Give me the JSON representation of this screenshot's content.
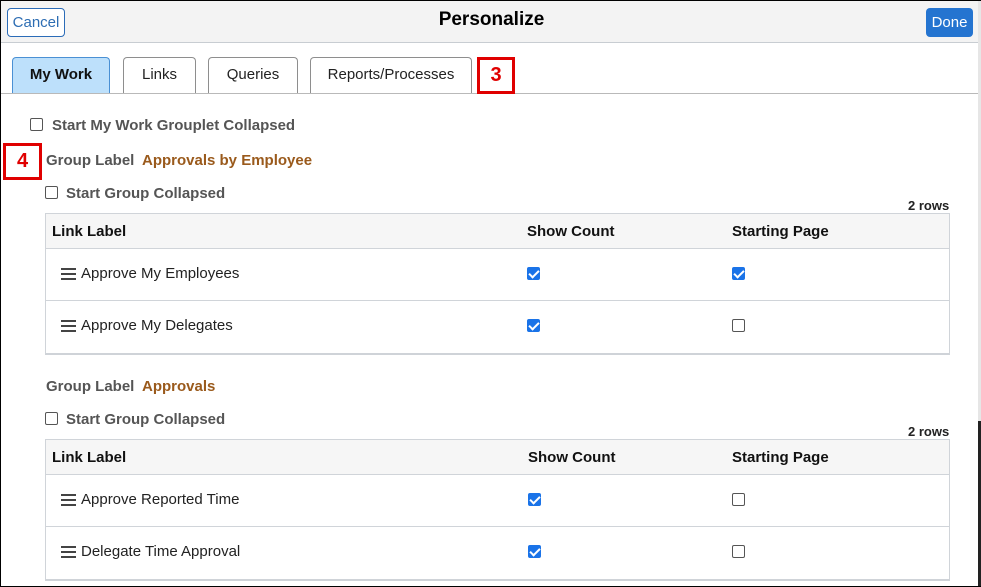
{
  "header": {
    "title": "Personalize",
    "cancel_label": "Cancel",
    "done_label": "Done"
  },
  "tabs": [
    {
      "label": "My Work",
      "active": true
    },
    {
      "label": "Links",
      "active": false
    },
    {
      "label": "Queries",
      "active": false
    },
    {
      "label": "Reports/Processes",
      "active": false
    }
  ],
  "callouts": {
    "tabs_marker": "3",
    "group_marker": "4"
  },
  "grouplet": {
    "collapsed_label": "Start My Work Grouplet Collapsed",
    "collapsed": false
  },
  "groups": [
    {
      "label_caption": "Group Label",
      "label_value": "Approvals by Employee",
      "collapsed_label": "Start Group Collapsed",
      "collapsed": false,
      "row_count": "2 rows",
      "columns": [
        "Link Label",
        "Show Count",
        "Starting Page"
      ],
      "rows": [
        {
          "link_label": "Approve My Employees",
          "show_count": true,
          "starting_page": true
        },
        {
          "link_label": "Approve My Delegates",
          "show_count": true,
          "starting_page": false
        }
      ]
    },
    {
      "label_caption": "Group Label",
      "label_value": "Approvals",
      "collapsed_label": "Start Group Collapsed",
      "collapsed": false,
      "row_count": "2 rows",
      "columns": [
        "Link Label",
        "Show Count",
        "Starting Page"
      ],
      "rows": [
        {
          "link_label": "Approve Reported Time",
          "show_count": true,
          "starting_page": false
        },
        {
          "link_label": "Delegate Time Approval",
          "show_count": true,
          "starting_page": false
        }
      ]
    }
  ],
  "colors": {
    "accent": "#2474d0",
    "active_tab": "#bde0fb",
    "group_value": "#9a5a1c",
    "checkbox_on": "#1a73e8",
    "callout": "#e00000"
  }
}
